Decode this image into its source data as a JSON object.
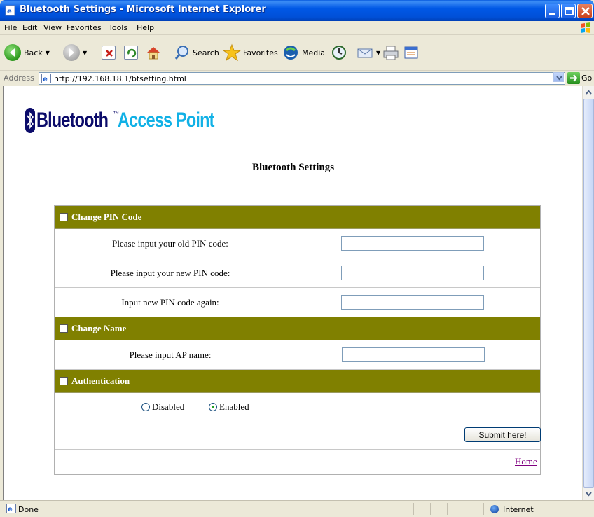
{
  "window": {
    "title": "Bluetooth Settings - Microsoft Internet Explorer"
  },
  "menu": [
    "File",
    "Edit",
    "View",
    "Favorites",
    "Tools",
    "Help"
  ],
  "toolbar": {
    "back": "Back",
    "search": "Search",
    "favorites": "Favorites",
    "media": "Media"
  },
  "address": {
    "label": "Address",
    "url": "http://192.168.18.1/btsetting.html",
    "go": "Go"
  },
  "page": {
    "logo_bluetooth": "Bluetooth",
    "logo_tm": "™",
    "logo_access_point": "Access Point",
    "heading": "Bluetooth Settings",
    "sections": {
      "pin": "Change PIN Code",
      "name": "Change Name",
      "auth": "Authentication"
    },
    "fields": {
      "old_pin": "Please input your old PIN code:",
      "new_pin": "Please input your new PIN code:",
      "confirm_pin": "Input new PIN code again:",
      "ap_name": "Please input AP name:"
    },
    "auth_options": {
      "disabled": "Disabled",
      "enabled": "Enabled",
      "selected": "Enabled"
    },
    "submit": "Submit here!",
    "home": "Home"
  },
  "status": {
    "text": "Done",
    "zone": "Internet"
  },
  "colors": {
    "section_bg": "#808000",
    "title_bar": "#0058e6",
    "logo_dark": "#0b0b6a",
    "logo_light": "#11b1e6",
    "visited_link": "#800080"
  }
}
